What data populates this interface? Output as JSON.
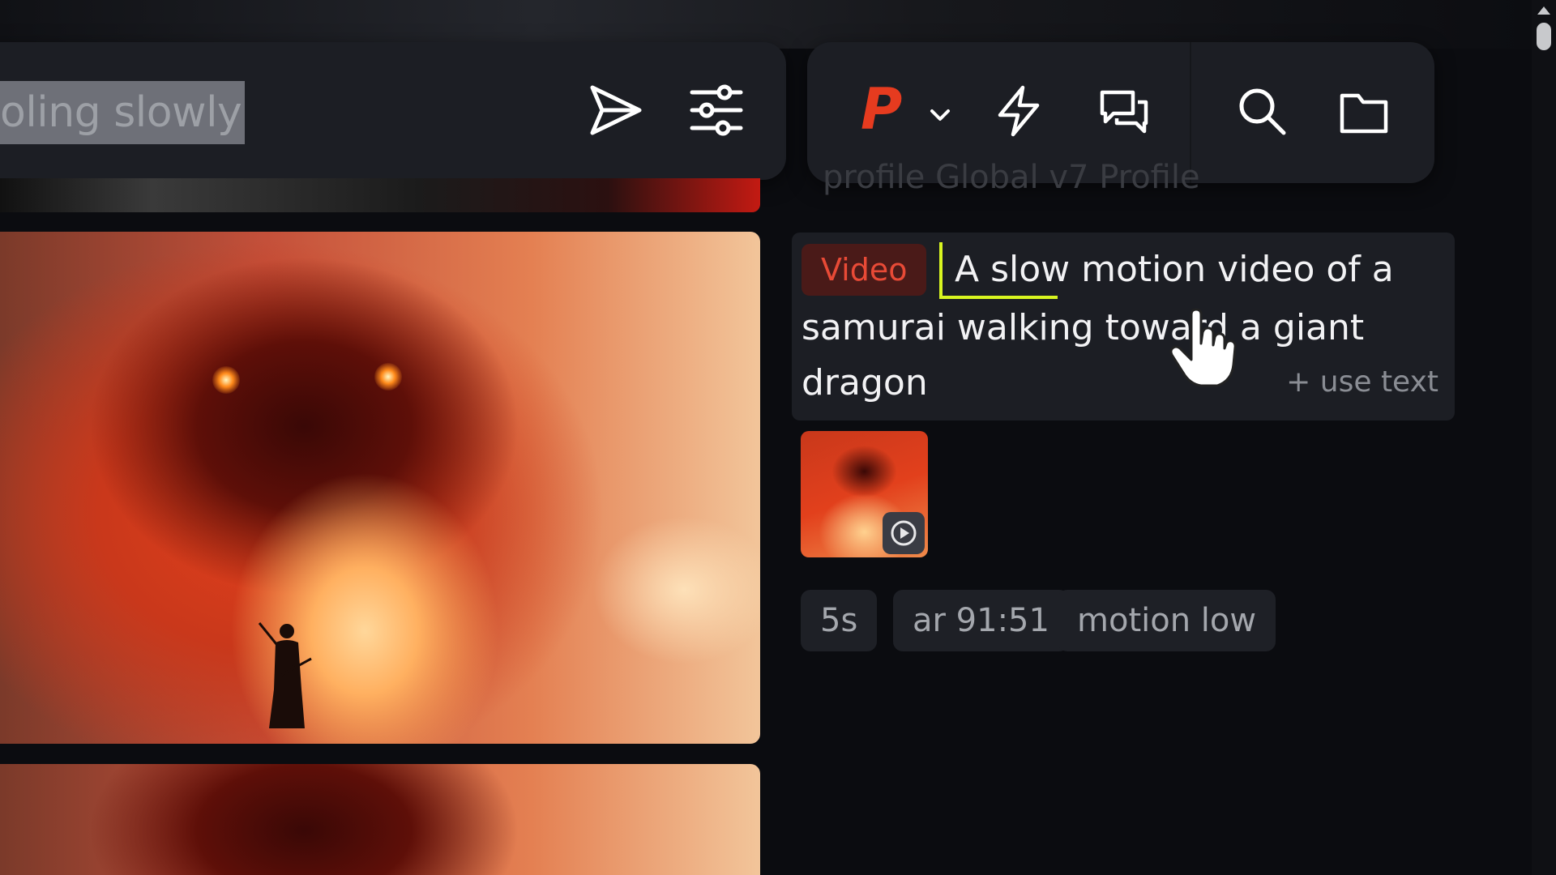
{
  "prompt_bar": {
    "text": "oling slowly",
    "send_icon": "send-icon",
    "settings_icon": "sliders-icon"
  },
  "toolbar": {
    "profile_letter": "P",
    "profile_color": "#e63b1f",
    "icons": [
      "chevron-down-icon",
      "bolt-icon",
      "chat-icon",
      "search-icon",
      "folder-icon"
    ]
  },
  "ghost_text": "profile Global v7 Profile",
  "prompt_card": {
    "badge": "Video",
    "line1": "A slow motion video of a",
    "line2": "samurai walking toward a giant",
    "line3": "dragon",
    "use_text": "+ use text",
    "highlight_color": "#d8f520"
  },
  "chips": [
    "5s",
    "ar 91:51",
    "motion low"
  ]
}
